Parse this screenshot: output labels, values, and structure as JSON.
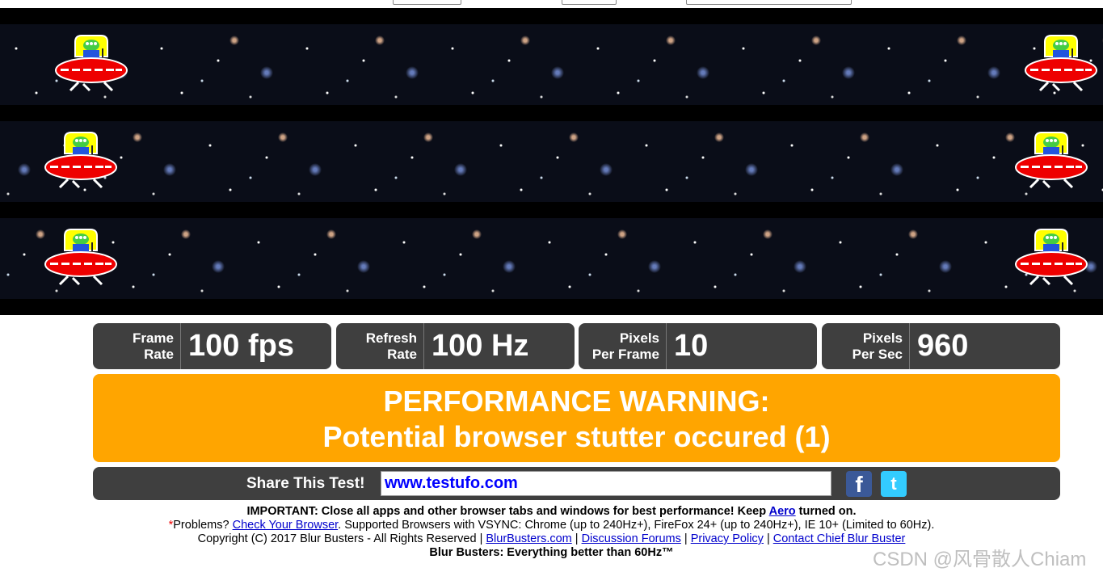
{
  "stats": [
    {
      "label1": "Frame",
      "label2": "Rate",
      "value": "100 fps"
    },
    {
      "label1": "Refresh",
      "label2": "Rate",
      "value": "100 Hz"
    },
    {
      "label1": "Pixels",
      "label2": "Per Frame",
      "value": "10"
    },
    {
      "label1": "Pixels",
      "label2": "Per Sec",
      "value": "960"
    }
  ],
  "warning": {
    "line1": "PERFORMANCE WARNING:",
    "line2": "Potential browser stutter occured (1)",
    "color": "#FFA500"
  },
  "share": {
    "label": "Share This Test!",
    "url": "www.testufo.com",
    "icons": [
      "facebook-icon",
      "twitter-icon"
    ]
  },
  "footer": {
    "important": "IMPORTANT: Close all apps and other browser tabs and windows for best performance! Keep ",
    "aero": "Aero",
    "turned_on": " turned on.",
    "asterisk": "*",
    "problems": "Problems? ",
    "check": "Check Your Browser",
    "supported": ". Supported Browsers with VSYNC: Chrome (up to 240Hz+), FireFox 24+ (up to 240Hz+), IE 10+ (Limited to 60Hz).",
    "copyright": "Copyright (C) 2017 Blur Busters - All Rights Reserved | ",
    "links": [
      "BlurBusters.com",
      "Discussion Forums",
      "Privacy Policy",
      "Contact Chief Blur Buster"
    ],
    "tagline": "Blur Busters: Everything better than 60Hz™"
  },
  "watermark": "CSDN @风骨散人Chiam"
}
